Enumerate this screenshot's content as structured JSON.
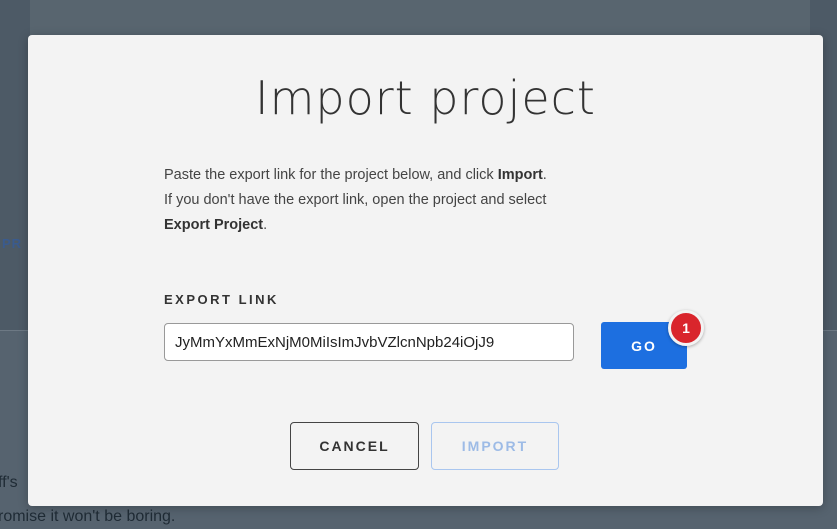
{
  "background": {
    "side_label": "PR",
    "footer_line1": "ff's",
    "footer_line2": "romise it won't be boring."
  },
  "dialog": {
    "title": "Import project",
    "description": {
      "line1_text": "Paste the export link for the project below, and click ",
      "line1_bold": "Import",
      "line1_end": ".",
      "line2_text": "If you don't have the export link, open the project and select",
      "line3_bold": "Export Project",
      "line3_end": "."
    },
    "export_link": {
      "label": "EXPORT LINK",
      "value": "JyMmYxMmExNjM0MiIsImJvbVZlcnNpb24iOjJ9"
    },
    "go_label": "GO",
    "badge_count": "1",
    "cancel_label": "CANCEL",
    "import_label": "IMPORT",
    "colors": {
      "primary": "#1d6fe0",
      "badge": "#d9252c",
      "disabled": "#9dbbe6"
    }
  }
}
